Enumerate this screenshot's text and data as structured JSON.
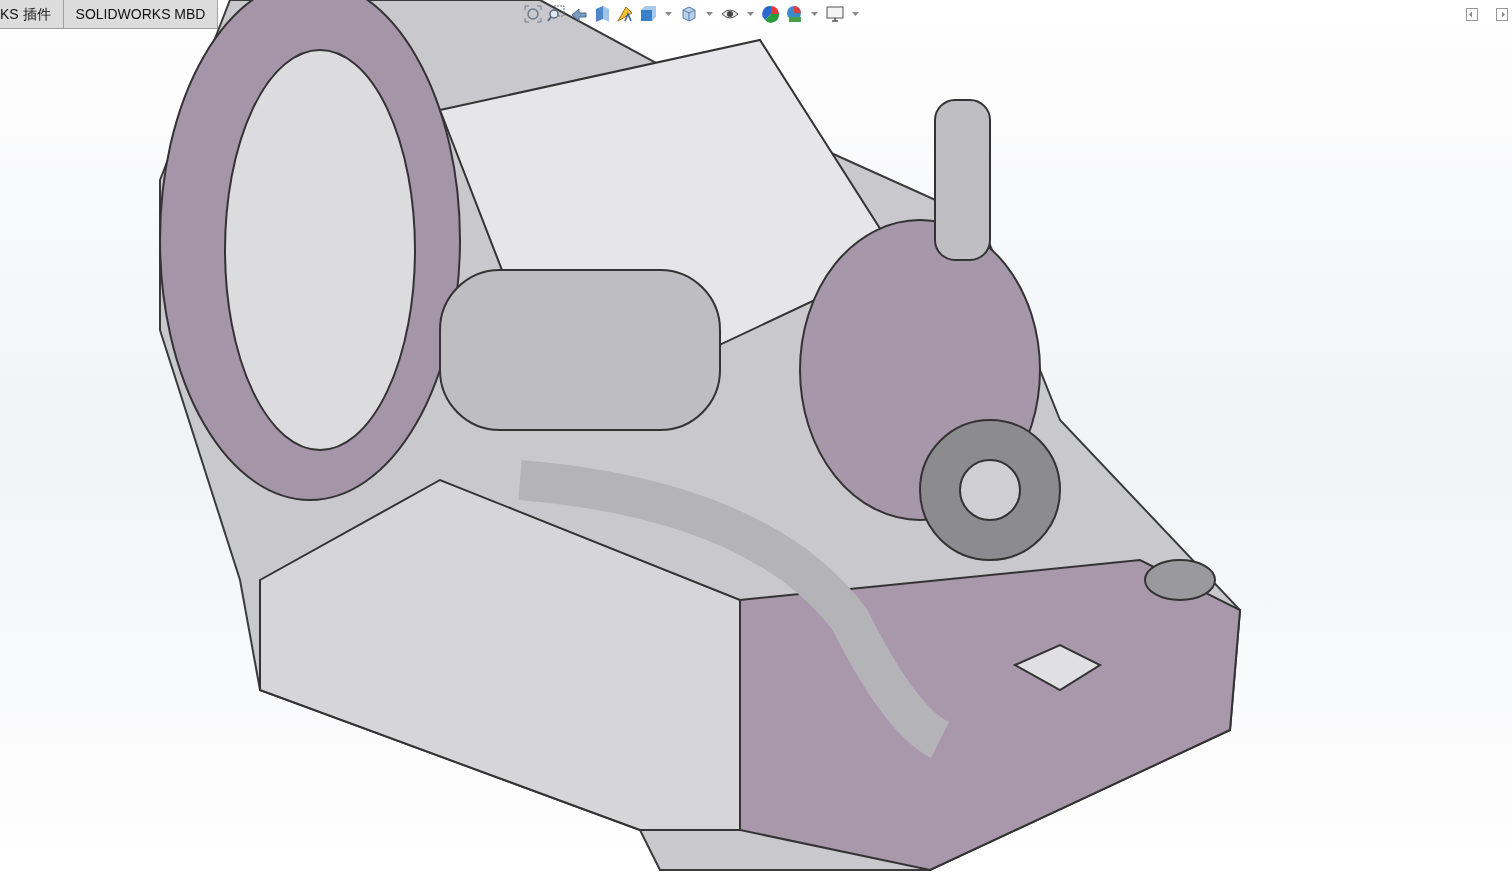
{
  "command_tabs": [
    {
      "label": "KS 插件",
      "selected": false
    },
    {
      "label": "SOLIDWORKS MBD",
      "selected": false
    }
  ]
}
